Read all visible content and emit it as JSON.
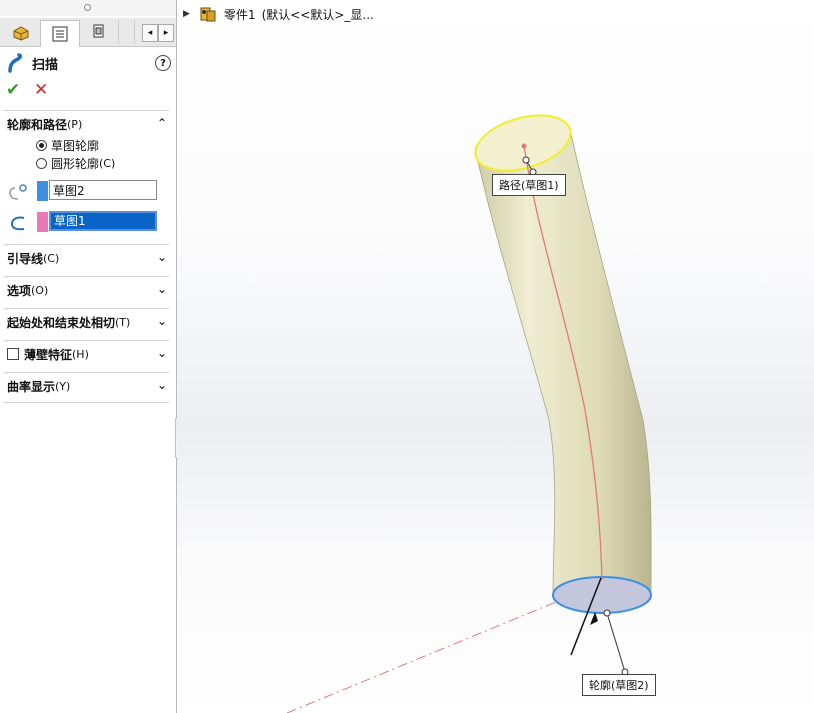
{
  "panel": {
    "feature_title": "扫描",
    "help_label": "?",
    "ok_label": "✔",
    "cancel_label": "✕",
    "sections": {
      "profile_path": {
        "label": "轮廓和路径",
        "key": "(P)"
      },
      "guides": {
        "label": "引导线",
        "key": "(C)"
      },
      "options": {
        "label": "选项",
        "key": "(O)"
      },
      "tangency": {
        "label": "起始处和结束处相切",
        "key": "(T)"
      },
      "thin": {
        "label": "薄壁特征",
        "key": "(H)"
      },
      "curvature": {
        "label": "曲率显示",
        "key": "(Y)"
      }
    },
    "radio_sketch_profile": "草图轮廓",
    "radio_circle_profile": "圆形轮廓",
    "radio_circle_key": "(C)",
    "profile_field_value": "草图2",
    "path_field_value": "草图1",
    "colors": {
      "profile_swatch": "#3f8fe0",
      "path_swatch": "#e878b8"
    }
  },
  "viewport": {
    "tree_label": "零件1",
    "tree_config": "(默认<<默认>_显...",
    "callout_path": "路径(草图1)",
    "callout_profile": "轮廓(草图2)"
  },
  "colors": {
    "tube_fill": "#e8e6c8",
    "top_edge": "#f2ee2a",
    "bottom_edge": "#3a8fe6",
    "path_curve": "#e07a7a",
    "ok": "#3a9b2e",
    "cancel": "#cc2a2a"
  }
}
